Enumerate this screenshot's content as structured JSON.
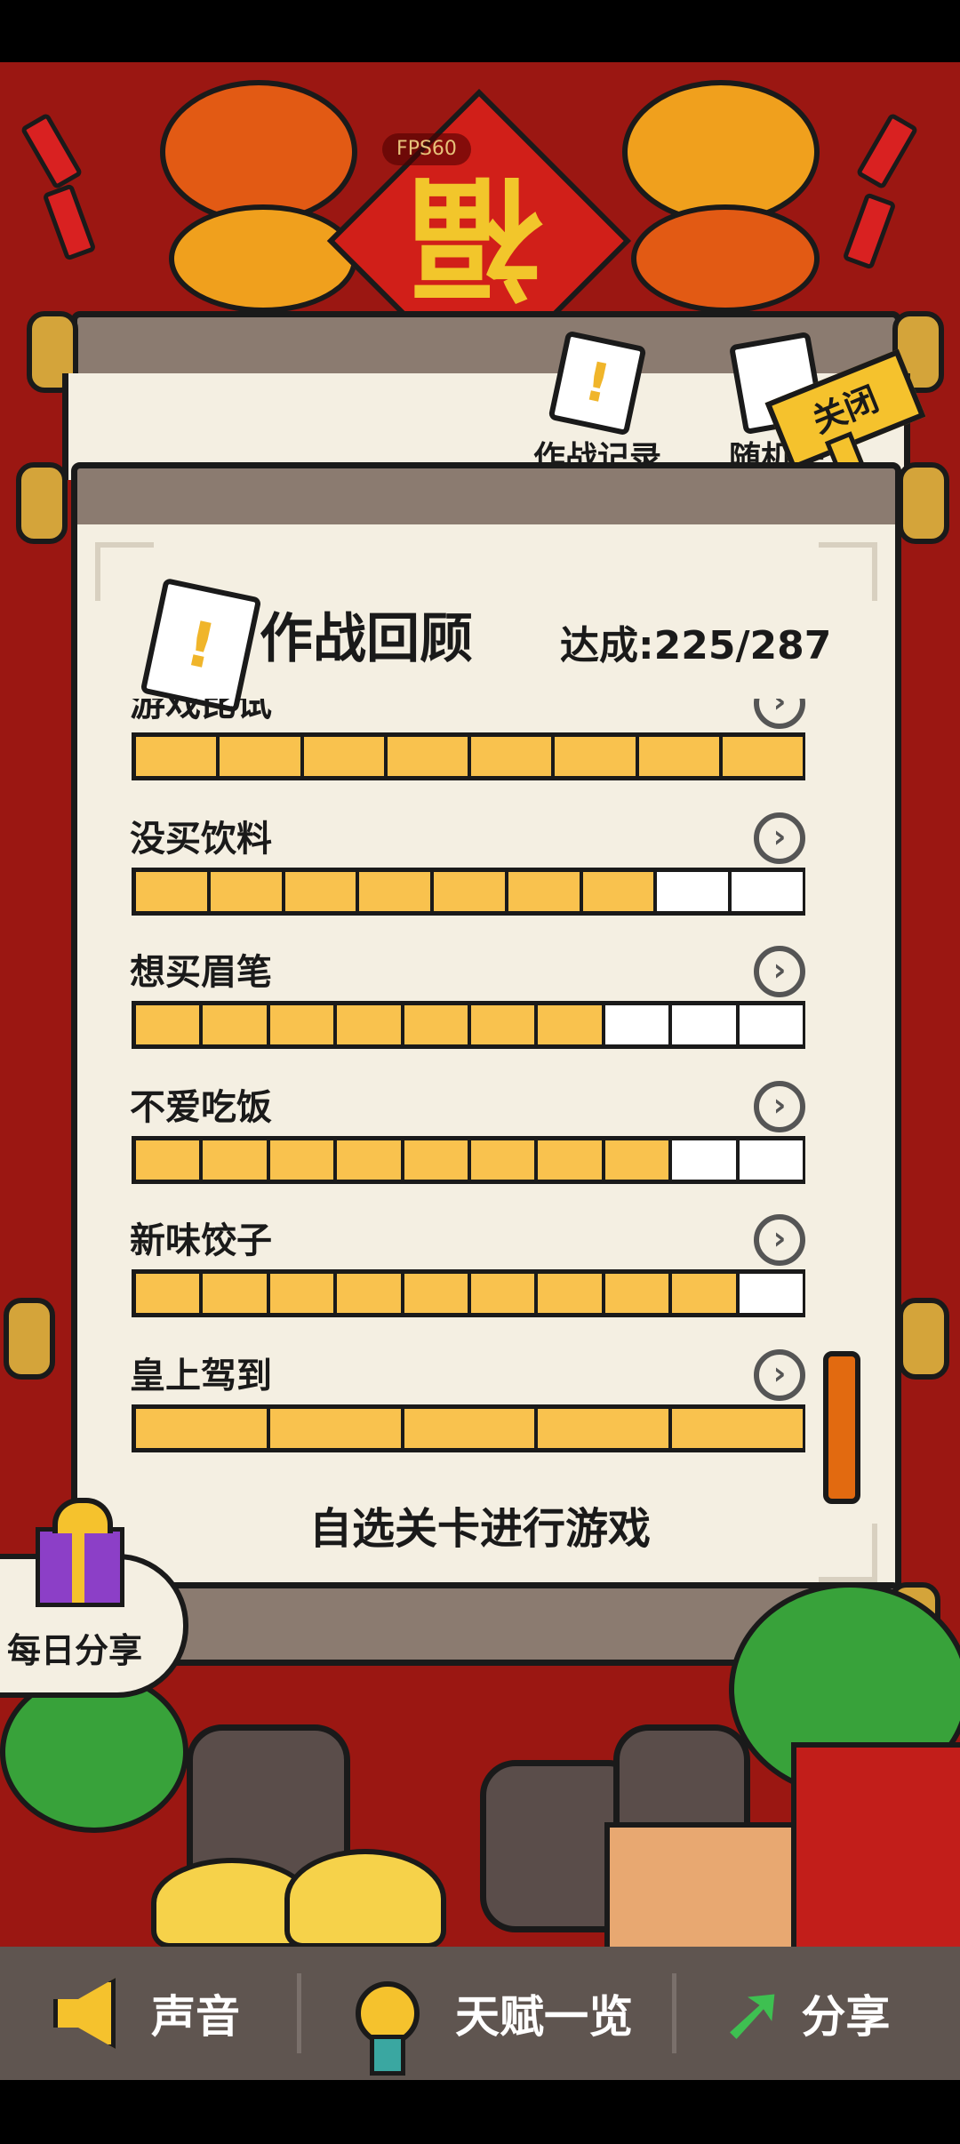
{
  "fps": "FPS60",
  "tabs": [
    {
      "label": "作战记录"
    },
    {
      "label": "随机关"
    }
  ],
  "close_label": "关闭",
  "panel": {
    "title": "作战回顾",
    "progress": "达成:225/287"
  },
  "levels": [
    {
      "name": "游戏比试",
      "segments": 8,
      "filled": 8
    },
    {
      "name": "没买饮料",
      "segments": 9,
      "filled": 7
    },
    {
      "name": "想买眉笔",
      "segments": 10,
      "filled": 7
    },
    {
      "name": "不爱吃饭",
      "segments": 10,
      "filled": 8
    },
    {
      "name": "新味饺子",
      "segments": 10,
      "filled": 9
    },
    {
      "name": "皇上驾到",
      "segments": 5,
      "filled": 5
    }
  ],
  "select_level_label": "自选关卡进行游戏",
  "daily_share_label": "每日分享",
  "nav": {
    "sound": "声音",
    "talents": "天赋一览",
    "share": "分享"
  },
  "icons": {
    "fu_character": "福",
    "exclamation": "!",
    "arrow": "›",
    "share_arrow": "➚"
  },
  "colors": {
    "background": "#9b1712",
    "bar_filled": "#f9c24e",
    "bar_empty": "#ffffff",
    "nav_bg": "#5f5550"
  }
}
